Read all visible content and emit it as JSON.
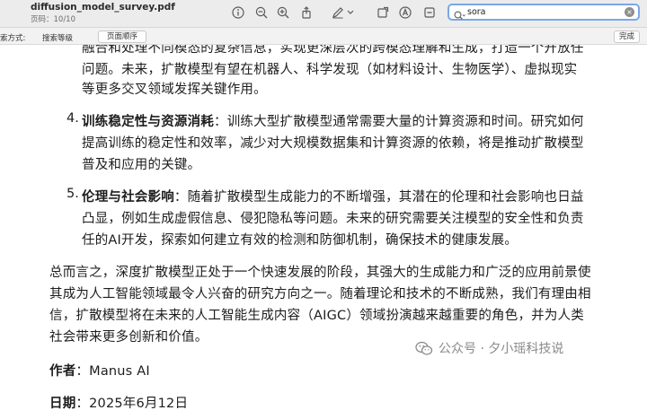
{
  "toolbar": {
    "title": "diffusion_model_survey.pdf",
    "subtitle": "页码：10/10",
    "search_value": "sora"
  },
  "findbar": {
    "mode_label": "索方式:",
    "tab_rank": "搜索等级",
    "tab_order": "页面顺序",
    "done": "完成"
  },
  "content": {
    "lines": [
      "融合和处理不同模态的复杂信息，实现更深层次的跨模态理解和生成，打造一个开放任",
      "问题。未来，扩散模型有望在机器人、科学发现（如材料设计、生物医学）、虚拟现实",
      "等更多交叉领域发挥关键作用。"
    ],
    "item4": {
      "num": "4.",
      "bold": "训练稳定性与资源消耗",
      "sep": "：",
      "lines": [
        "训练大型扩散模型通常需要大量的计算资源和时间。研究如何",
        "提高训练的稳定性和效率，减少对大规模数据集和计算资源的依赖，将是推动扩散模型",
        "普及和应用的关键。"
      ]
    },
    "item5": {
      "num": "5.",
      "bold": "伦理与社会影响",
      "sep": "：",
      "lines": [
        "随着扩散模型生成能力的不断增强，其潜在的伦理和社会影响也日益",
        "凸显，例如生成虚假信息、侵犯隐私等问题。未来的研究需要关注模型的安全性和负责",
        "任的AI开发，探索如何建立有效的检测和防御机制，确保技术的健康发展。"
      ]
    },
    "summary": [
      "总而言之，深度扩散模型正处于一个快速发展的阶段，其强大的生成能力和广泛的应用前景使",
      "其成为人工智能领域最令人兴奋的研究方向之一。随着理论和技术的不断成熟，我们有理由相",
      "信，扩散模型将在未来的人工智能生成内容（AIGC）领域扮演越来越重要的角色，并为人类",
      "社会带来更多创新和价值。"
    ],
    "author_label": "作者",
    "author_value": "：Manus AI",
    "date_label": "日期",
    "date_value": "：2025年6月12日"
  },
  "watermark": "公众号 · 夕小瑶科技说"
}
